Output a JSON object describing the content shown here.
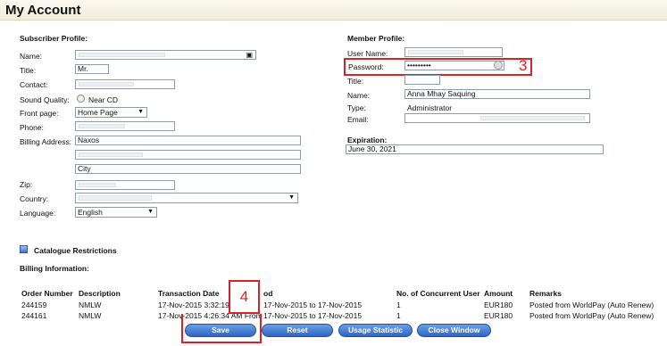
{
  "page": {
    "title": "My Account"
  },
  "subscriber": {
    "heading": "Subscriber Profile:",
    "name_label": "Name:",
    "title_label": "Title:",
    "title_value": "Mr.",
    "contact_label": "Contact:",
    "sound_label": "Sound Quality:",
    "sound_option": "Near CD",
    "frontpage_label": "Front page:",
    "frontpage_value": "Home Page",
    "phone_label": "Phone:",
    "billing_label": "Billing Address:",
    "billing_line1": "Naxos",
    "billing_city": "City",
    "zip_label": "Zip:",
    "country_label": "Country:",
    "language_label": "Language:",
    "language_value": "English"
  },
  "member": {
    "heading": "Member Profile:",
    "username_label": "User Name:",
    "password_label": "Password:",
    "password_value": "•••••••••",
    "title_label": "Title:",
    "name_label": "Name:",
    "name_value": "Anna Mhay Saquing",
    "type_label": "Type:",
    "type_value": "Administrator",
    "email_label": "Email:",
    "expiration_heading": "Expiration:",
    "expiration_value": "June 30, 2021"
  },
  "annotations": {
    "callout3": "3",
    "callout4": "4",
    "color": "#d6232b"
  },
  "catalogue": {
    "label": "Catalogue Restrictions"
  },
  "billing": {
    "heading": "Billing Information:",
    "columns": [
      "Order Number",
      "Description",
      "Transaction Date",
      "od",
      "No. of Concurrent User",
      "Amount",
      "Remarks"
    ],
    "rows": [
      {
        "order": "244159",
        "desc": "NMLW",
        "date": "17-Nov-2015 3:32:19",
        "period": "17-Nov-2015 to 17-Nov-2015",
        "users": "1",
        "amount": "EUR180",
        "remarks": "Posted from WorldPay (Auto Renew)"
      },
      {
        "order": "244161",
        "desc": "NMLW",
        "date": "17-Nov-2015 4:26:34 AM From",
        "period": "17-Nov-2015 to 17-Nov-2015",
        "users": "1",
        "amount": "EUR180",
        "remarks": "Posted from WorldPay (Auto Renew)"
      }
    ]
  },
  "buttons": {
    "save": "Save",
    "reset": "Reset",
    "usage": "Usage Statistic",
    "close": "Close Window"
  },
  "colors": {
    "button": "#2f66c4",
    "titlebar": "#f4f0e3"
  }
}
